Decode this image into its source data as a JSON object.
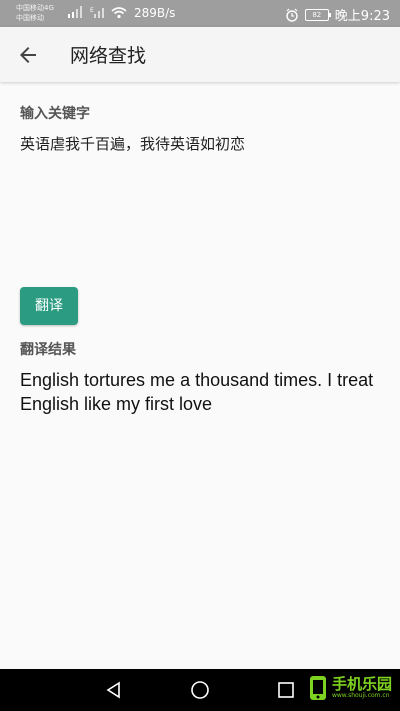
{
  "status": {
    "carrier1": "中国移动4G",
    "carrier2": "中国移动",
    "speed": "289B/s",
    "battery": "82",
    "time": "晚上9:23"
  },
  "appbar": {
    "title": "网络查找"
  },
  "input": {
    "label": "输入关键字",
    "value": "英语虐我千百遍，我待英语如初恋"
  },
  "translate_button": {
    "label": "翻译"
  },
  "result": {
    "label": "翻译结果",
    "text": "English tortures me a thousand times. I treat English like my first love"
  },
  "watermark": {
    "text": "手机乐园",
    "sub": "www.shouji.com.cn"
  },
  "colors": {
    "accent": "#2b9c82",
    "statusbar": "#9e9e9e",
    "navbar": "#000000"
  }
}
